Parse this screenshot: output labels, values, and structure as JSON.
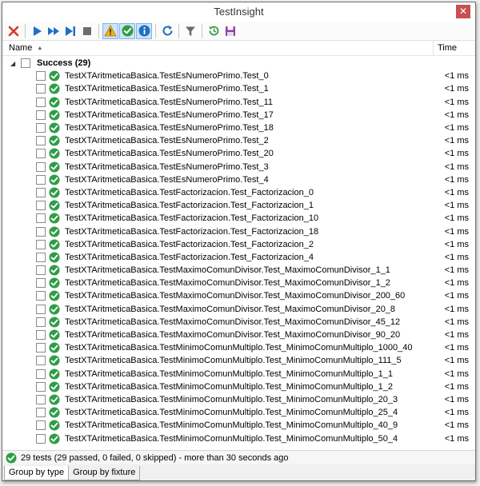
{
  "window": {
    "title": "TestInsight"
  },
  "toolbar": {
    "buttons": [
      {
        "name": "clear-icon"
      },
      {
        "name": "run-icon"
      },
      {
        "name": "run-all-icon"
      },
      {
        "name": "run-to-end-icon"
      },
      {
        "name": "stop-icon"
      },
      {
        "name": "show-warnings-icon"
      },
      {
        "name": "show-passed-icon"
      },
      {
        "name": "show-info-icon"
      },
      {
        "name": "refresh-icon"
      },
      {
        "name": "filter-icon"
      },
      {
        "name": "history-icon"
      },
      {
        "name": "save-icon"
      }
    ]
  },
  "columns": {
    "name": "Name",
    "time": "Time"
  },
  "group": {
    "label": "Success (29)"
  },
  "tests": [
    {
      "name": "TestXTAritmeticaBasica.TestEsNumeroPrimo.Test_0",
      "time": "<1 ms"
    },
    {
      "name": "TestXTAritmeticaBasica.TestEsNumeroPrimo.Test_1",
      "time": "<1 ms"
    },
    {
      "name": "TestXTAritmeticaBasica.TestEsNumeroPrimo.Test_11",
      "time": "<1 ms"
    },
    {
      "name": "TestXTAritmeticaBasica.TestEsNumeroPrimo.Test_17",
      "time": "<1 ms"
    },
    {
      "name": "TestXTAritmeticaBasica.TestEsNumeroPrimo.Test_18",
      "time": "<1 ms"
    },
    {
      "name": "TestXTAritmeticaBasica.TestEsNumeroPrimo.Test_2",
      "time": "<1 ms"
    },
    {
      "name": "TestXTAritmeticaBasica.TestEsNumeroPrimo.Test_20",
      "time": "<1 ms"
    },
    {
      "name": "TestXTAritmeticaBasica.TestEsNumeroPrimo.Test_3",
      "time": "<1 ms"
    },
    {
      "name": "TestXTAritmeticaBasica.TestEsNumeroPrimo.Test_4",
      "time": "<1 ms"
    },
    {
      "name": "TestXTAritmeticaBasica.TestFactorizacion.Test_Factorizacion_0",
      "time": "<1 ms"
    },
    {
      "name": "TestXTAritmeticaBasica.TestFactorizacion.Test_Factorizacion_1",
      "time": "<1 ms"
    },
    {
      "name": "TestXTAritmeticaBasica.TestFactorizacion.Test_Factorizacion_10",
      "time": "<1 ms"
    },
    {
      "name": "TestXTAritmeticaBasica.TestFactorizacion.Test_Factorizacion_18",
      "time": "<1 ms"
    },
    {
      "name": "TestXTAritmeticaBasica.TestFactorizacion.Test_Factorizacion_2",
      "time": "<1 ms"
    },
    {
      "name": "TestXTAritmeticaBasica.TestFactorizacion.Test_Factorizacion_4",
      "time": "<1 ms"
    },
    {
      "name": "TestXTAritmeticaBasica.TestMaximoComunDivisor.Test_MaximoComunDivisor_1_1",
      "time": "<1 ms"
    },
    {
      "name": "TestXTAritmeticaBasica.TestMaximoComunDivisor.Test_MaximoComunDivisor_1_2",
      "time": "<1 ms"
    },
    {
      "name": "TestXTAritmeticaBasica.TestMaximoComunDivisor.Test_MaximoComunDivisor_200_60",
      "time": "<1 ms"
    },
    {
      "name": "TestXTAritmeticaBasica.TestMaximoComunDivisor.Test_MaximoComunDivisor_20_8",
      "time": "<1 ms"
    },
    {
      "name": "TestXTAritmeticaBasica.TestMaximoComunDivisor.Test_MaximoComunDivisor_45_12",
      "time": "<1 ms"
    },
    {
      "name": "TestXTAritmeticaBasica.TestMaximoComunDivisor.Test_MaximoComunDivisor_90_20",
      "time": "<1 ms"
    },
    {
      "name": "TestXTAritmeticaBasica.TestMinimoComunMultiplo.Test_MinimoComunMultiplo_1000_40",
      "time": "<1 ms"
    },
    {
      "name": "TestXTAritmeticaBasica.TestMinimoComunMultiplo.Test_MinimoComunMultiplo_111_5",
      "time": "<1 ms"
    },
    {
      "name": "TestXTAritmeticaBasica.TestMinimoComunMultiplo.Test_MinimoComunMultiplo_1_1",
      "time": "<1 ms"
    },
    {
      "name": "TestXTAritmeticaBasica.TestMinimoComunMultiplo.Test_MinimoComunMultiplo_1_2",
      "time": "<1 ms"
    },
    {
      "name": "TestXTAritmeticaBasica.TestMinimoComunMultiplo.Test_MinimoComunMultiplo_20_3",
      "time": "<1 ms"
    },
    {
      "name": "TestXTAritmeticaBasica.TestMinimoComunMultiplo.Test_MinimoComunMultiplo_25_4",
      "time": "<1 ms"
    },
    {
      "name": "TestXTAritmeticaBasica.TestMinimoComunMultiplo.Test_MinimoComunMultiplo_40_9",
      "time": "<1 ms"
    },
    {
      "name": "TestXTAritmeticaBasica.TestMinimoComunMultiplo.Test_MinimoComunMultiplo_50_4",
      "time": "<1 ms"
    }
  ],
  "status": {
    "text": "29 tests (29 passed, 0 failed, 0 skipped) - more than 30 seconds ago"
  },
  "tabs": [
    {
      "label": "Group by type",
      "active": true
    },
    {
      "label": "Group by fixture",
      "active": false
    }
  ],
  "colors": {
    "success": "#2e9d45",
    "run": "#1f6fc2",
    "clear": "#d43a2a",
    "warning": "#f2b21c",
    "save": "#8b3fa8"
  }
}
